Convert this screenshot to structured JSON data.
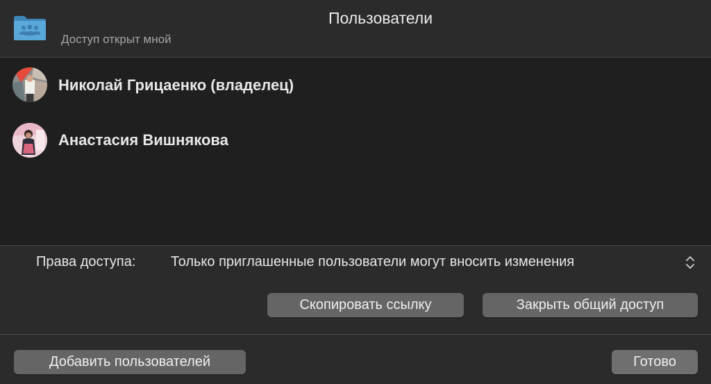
{
  "header": {
    "title": "Пользователи",
    "subtitle": "Доступ открыт мной",
    "folder_icon": "shared-folder-icon",
    "folder_color": "#5aa7d9"
  },
  "users": [
    {
      "name": "Николай Грицаенко (владелец)",
      "avatar": "avatar-photo"
    },
    {
      "name": "Анастасия Вишнякова",
      "avatar": "avatar-photo"
    }
  ],
  "permissions": {
    "label": "Права доступа:",
    "value": "Только приглашенные пользователи могут вносить изменения"
  },
  "buttons": {
    "copy_link": "Скопировать ссылку",
    "stop_sharing": "Закрыть общий доступ",
    "add_users": "Добавить пользователей",
    "done": "Готово"
  }
}
